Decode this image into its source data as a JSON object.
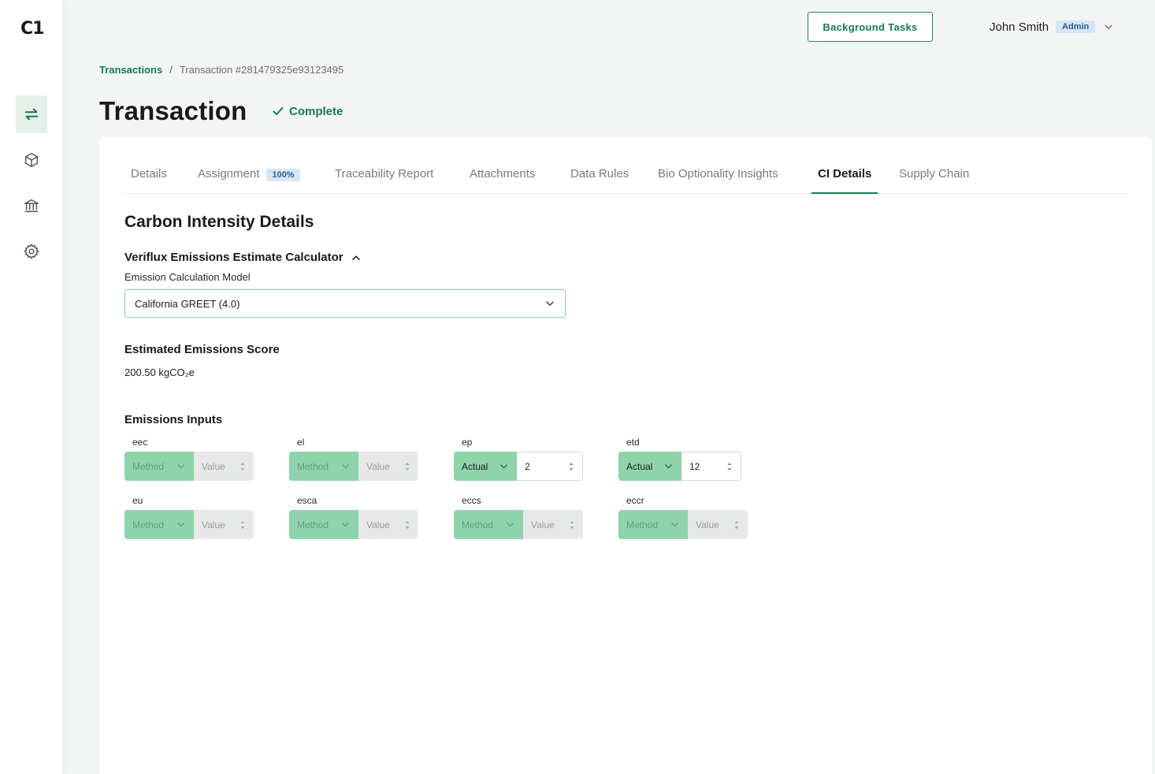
{
  "app": {
    "logo": "C1"
  },
  "sidebar": {
    "items": [
      {
        "name": "transactions",
        "icon": "swap-arrows-icon",
        "active": true
      },
      {
        "name": "products",
        "icon": "cube-icon",
        "active": false
      },
      {
        "name": "institutions",
        "icon": "bank-icon",
        "active": false
      },
      {
        "name": "settings",
        "icon": "gear-icon",
        "active": false
      }
    ]
  },
  "header": {
    "background_tasks_label": "Background Tasks",
    "user_name": "John Smith",
    "user_role": "Admin"
  },
  "breadcrumb": {
    "root": "Transactions",
    "separator": "/",
    "current": "Transaction #281479325e93123495"
  },
  "page": {
    "title": "Transaction",
    "status": "Complete"
  },
  "tabs": [
    {
      "label": "Details"
    },
    {
      "label": "Assignment",
      "badge": "100%"
    },
    {
      "label": "Traceability Report"
    },
    {
      "label": "Attachments"
    },
    {
      "label": "Data Rules"
    },
    {
      "label": "Bio Optionality Insights"
    },
    {
      "label": "CI Details",
      "active": true
    },
    {
      "label": "Supply Chain"
    }
  ],
  "ci": {
    "section_title": "Carbon Intensity Details",
    "calculator_title": "Veriflux Emissions Estimate Calculator",
    "model_label": "Emission Calculation Model",
    "model_value": "California GREET (4.0)",
    "score_title": "Estimated Emissions Score",
    "score_value": "200.50 kgCO₂e",
    "inputs_title": "Emissions Inputs",
    "inputs": [
      {
        "label": "eec",
        "method": "Method",
        "value": "Value"
      },
      {
        "label": "el",
        "method": "Method",
        "value": "Value"
      },
      {
        "label": "ep",
        "method": "Actual",
        "value": "2"
      },
      {
        "label": "etd",
        "method": "Actual",
        "value": "12"
      },
      {
        "label": "eu",
        "method": "Method",
        "value": "Value"
      },
      {
        "label": "esca",
        "method": "Method",
        "value": "Value"
      },
      {
        "label": "eccs",
        "method": "Method",
        "value": "Value"
      },
      {
        "label": "eccr",
        "method": "Method",
        "value": "Value"
      }
    ]
  },
  "colors": {
    "accent": "#177a4e",
    "method_bg": "#8fd3ab",
    "badge_bg": "#d6e6f5",
    "badge_text": "#2a5d91"
  }
}
